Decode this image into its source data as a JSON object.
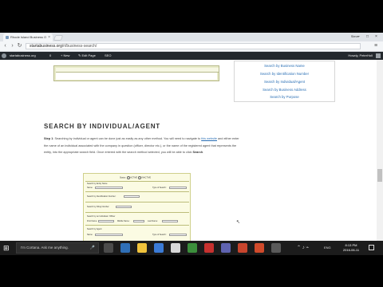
{
  "browser": {
    "tab_title": "Rhode Island Business O",
    "tab_close": "×",
    "user_label": "Steve",
    "url_host": "startabusiness.org",
    "url_path": "/ri/business-search/",
    "nav": {
      "back": "‹",
      "forward": "›",
      "reload": "↻",
      "menu": "≡"
    },
    "window_controls": {
      "minimize": "–",
      "maximize": "□",
      "close": "×"
    }
  },
  "wp_admin_bar": {
    "site_name": "startabusiness.org",
    "comments": "0",
    "new": "+ New",
    "edit_page": "✎ Edit Page",
    "seo": "SEO",
    "howdy": "Howdy, PeterHoll"
  },
  "sidebar": {
    "links": [
      "Search by Business Name",
      "Search by Identification Number",
      "Search by Individual/Agent",
      "Search by Business Address",
      "Search by Purpose"
    ]
  },
  "main": {
    "section_title": "SEARCH BY INDIVIDUAL/AGENT",
    "step_label": "Step 1",
    "step_text_1": ": Searching by individual or agent can be done just as easily as any other method. You will need to navigate to ",
    "step_link": "this website",
    "step_text_2": " and either enter the name of an individual associated with the company in question (officer, director etc.), or the name of the registered agent that represents the entity, into the appropriate search field. Once entered with the search method selected, you will be able to click ",
    "step_end": "Search",
    "step_period": "."
  },
  "form_image": {
    "status_label": "Status:",
    "active": "ACTIVE",
    "inactive": "INACTIVE",
    "labels": [
      "Search by Entity Name",
      "Name:",
      "Type of Search:",
      "Search by Identification Number:",
      "Search by Filing Number:",
      "Search by an Individual / Officer",
      "First Name:",
      "Middle Name:",
      "Last Name:",
      "Search by Agent:",
      "Name:",
      "Type of Search:",
      "Search by a Business Address:"
    ]
  },
  "taskbar": {
    "start": "⊞",
    "search_placeholder": "I'm Cortana. Ask me anything.",
    "mic": "🎤",
    "language": "ENG",
    "time": "8:13 PM",
    "date": "2016-06-11"
  }
}
